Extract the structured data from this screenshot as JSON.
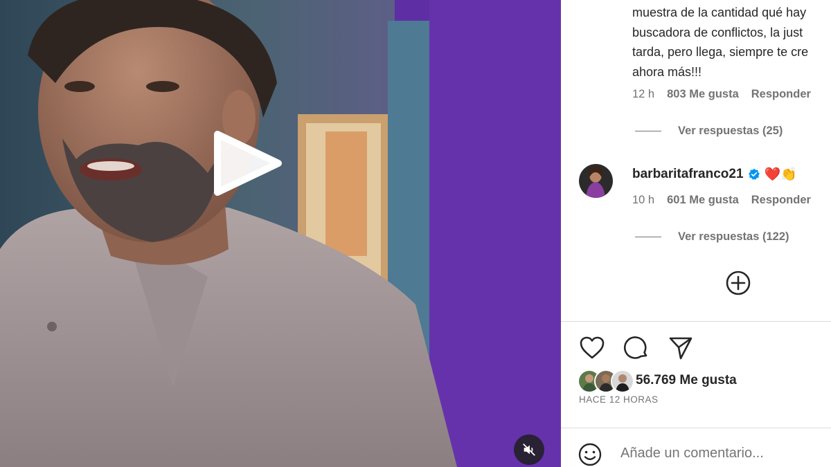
{
  "video": {
    "play_icon": "play-icon",
    "mute_icon": "muted-speaker-icon"
  },
  "comment1": {
    "text_lines": [
      "muestra de la cantidad qué hay",
      "buscadora de conflictos, la just",
      "tarda, pero llega, siempre te cre",
      "ahora más!!!"
    ],
    "time": "12 h",
    "likes": "803 Me gusta",
    "reply": "Responder",
    "view_replies": "Ver respuestas (25)"
  },
  "comment2": {
    "username": "barbaritafranco21",
    "text": "❤️👏",
    "time": "10 h",
    "likes": "601 Me gusta",
    "reply": "Responder",
    "view_replies": "Ver respuestas (122)"
  },
  "load_more_icon": "plus-circle-icon",
  "actions": {
    "like_icon": "heart-icon",
    "comment_icon": "comment-bubble-icon",
    "share_icon": "paper-plane-icon"
  },
  "post": {
    "likes": "56.769 Me gusta",
    "time_ago": "HACE 12 HORAS"
  },
  "composer": {
    "emoji_icon": "smiley-icon",
    "placeholder": "Añade un comentario..."
  },
  "colors": {
    "text": "#262626",
    "secondary": "#737373",
    "verified": "#0095f6",
    "divider": "#dbdbdb"
  }
}
